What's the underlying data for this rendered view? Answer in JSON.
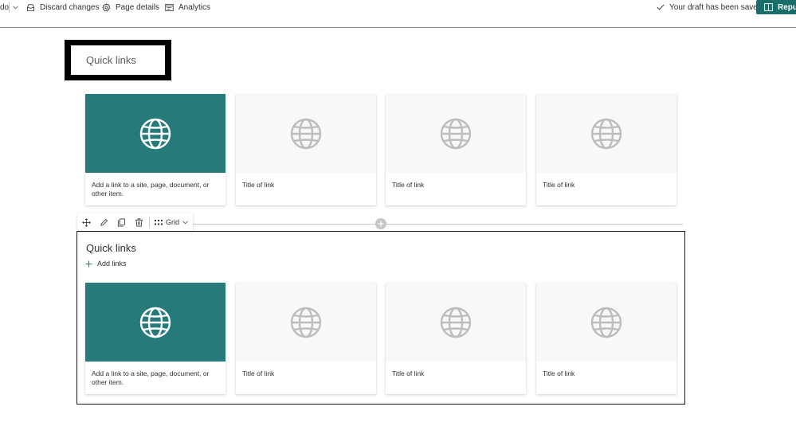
{
  "topbar": {
    "undo_label": "do",
    "discard_label": "Discard changes",
    "details_label": "Page details",
    "analytics_label": "Analytics",
    "saved_label": "Your draft has been saved",
    "republish_label": "Repub"
  },
  "top_section": {
    "title": "Quick links",
    "cards": [
      {
        "label": "Add a link to a site, page, document, or other item."
      },
      {
        "label": "Title of link"
      },
      {
        "label": "Title of link"
      },
      {
        "label": "Title of link"
      }
    ]
  },
  "toolbar": {
    "grid_label": "Grid"
  },
  "bottom_section": {
    "title": "Quick links",
    "add_links_label": "Add links",
    "cards": [
      {
        "label": "Add a link to a site, page, document, or other item."
      },
      {
        "label": "Title of link"
      },
      {
        "label": "Title of link"
      },
      {
        "label": "Title of link"
      }
    ]
  },
  "colors": {
    "accent": "#267a7a",
    "republish": "#1a6e6a",
    "placeholder_bg": "#f8f8f8",
    "globe_grey": "#bdbdbd"
  }
}
